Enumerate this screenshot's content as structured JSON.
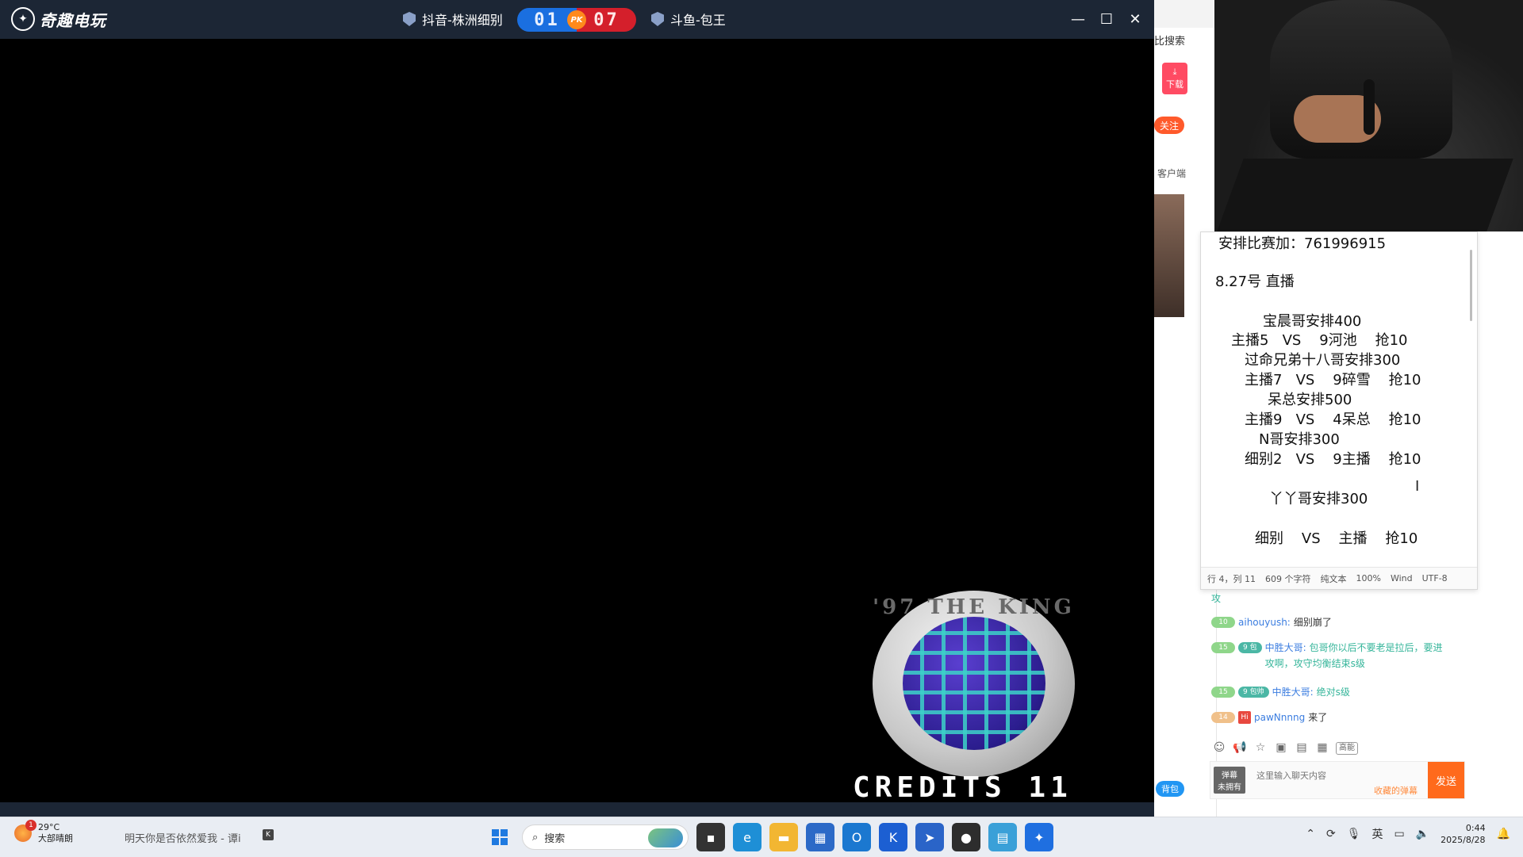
{
  "game_window": {
    "brand": "奇趣电玩",
    "player_left": "抖音-株洲细别",
    "score_left": "01",
    "pk_label": "PK",
    "score_right": "07",
    "player_right": "斗鱼-包王",
    "controls": {
      "minimize": "—",
      "maximize": "☐",
      "close": "✕"
    },
    "ring_text": "'97 THE KING",
    "credits": "CREDITS 11"
  },
  "stream_app": {
    "search_frag": "比搜索",
    "download_label": "下载",
    "follow_label": "关注",
    "client_label": "客户端",
    "mini_btn": "背包"
  },
  "note": {
    "lines": [
      "安排比赛加：761996915",
      "8.27号 直播",
      "宝晨哥安排400",
      "主播5   VS    9河池    抢10",
      "过命兄弟十八哥安排300",
      "主播7   VS    9碎雪    抢10",
      "呆总安排500",
      "主播9   VS    4呆总    抢10",
      "N哥安排300",
      "细别2   VS    9主播    抢10",
      "丫丫哥安排300",
      "细别    VS    主播    抢10"
    ],
    "status": [
      "行 4，列 11",
      "609 个字符",
      "纯文本",
      "100%",
      "Wind",
      "UTF-8"
    ]
  },
  "chat": {
    "first_fragment": "攻",
    "messages": [
      {
        "level": "10",
        "fan": "",
        "user": "aihouyush:",
        "text": "细别崩了"
      },
      {
        "level": "15",
        "fan": "9 包帅",
        "user": "中胜大哥:",
        "text": "包哥你以后不要老是拉后，要进攻啊，攻守均衡结束s级"
      },
      {
        "level": "15",
        "fan": "9 包帅",
        "user": "中胜大哥:",
        "text": "绝对s级"
      },
      {
        "level": "14",
        "fan": "Hi",
        "user": "pawNnnng",
        "text": "来了"
      }
    ],
    "hd_label": "高能",
    "unowned_top": "弹幕",
    "unowned_label": "未拥有",
    "input_placeholder": "这里输入聊天内容",
    "collect_label": "收藏的弹幕",
    "send_label": "发送"
  },
  "taskbar": {
    "weather_badge": "1",
    "temperature": "29°C",
    "condition": "大部晴朗",
    "news": "明天你是否依然爱我 - 谭i",
    "search_label": "搜索",
    "ime": "英",
    "time": "0:44",
    "date": "2025/8/28"
  },
  "colors": {
    "title_bar": "#1c2635",
    "score_blue": "#1a6fe0",
    "score_red": "#d41f2b",
    "send": "#ff6a1c"
  }
}
